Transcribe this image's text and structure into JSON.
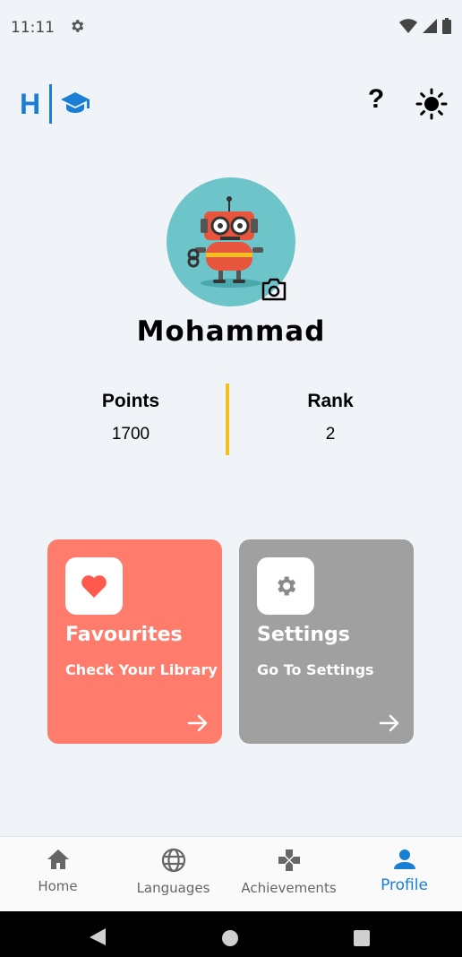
{
  "status_bar": {
    "time": "11:11"
  },
  "header": {
    "logo_letter": "H",
    "help_symbol": "?"
  },
  "profile": {
    "name": "Mohammad"
  },
  "stats": {
    "points_label": "Points",
    "points_value": "1700",
    "rank_label": "Rank",
    "rank_value": "2"
  },
  "cards": {
    "favourites": {
      "title": "Favourites",
      "subtitle": "Check Your Library",
      "color": "#ff7b6b",
      "icon": "heart-icon"
    },
    "settings": {
      "title": "Settings",
      "subtitle": "Go To Settings",
      "color": "#a0a0a0",
      "icon": "gear-icon"
    }
  },
  "nav": {
    "items": [
      {
        "label": "Home",
        "icon": "home-icon"
      },
      {
        "label": "Languages",
        "icon": "globe-icon"
      },
      {
        "label": "Achievements",
        "icon": "gamepad-icon"
      },
      {
        "label": "Profile",
        "icon": "person-icon"
      }
    ],
    "active_index": 3
  },
  "colors": {
    "accent": "#1a7fd4",
    "divider": "#f4c01d",
    "background": "#f0f4f8"
  }
}
